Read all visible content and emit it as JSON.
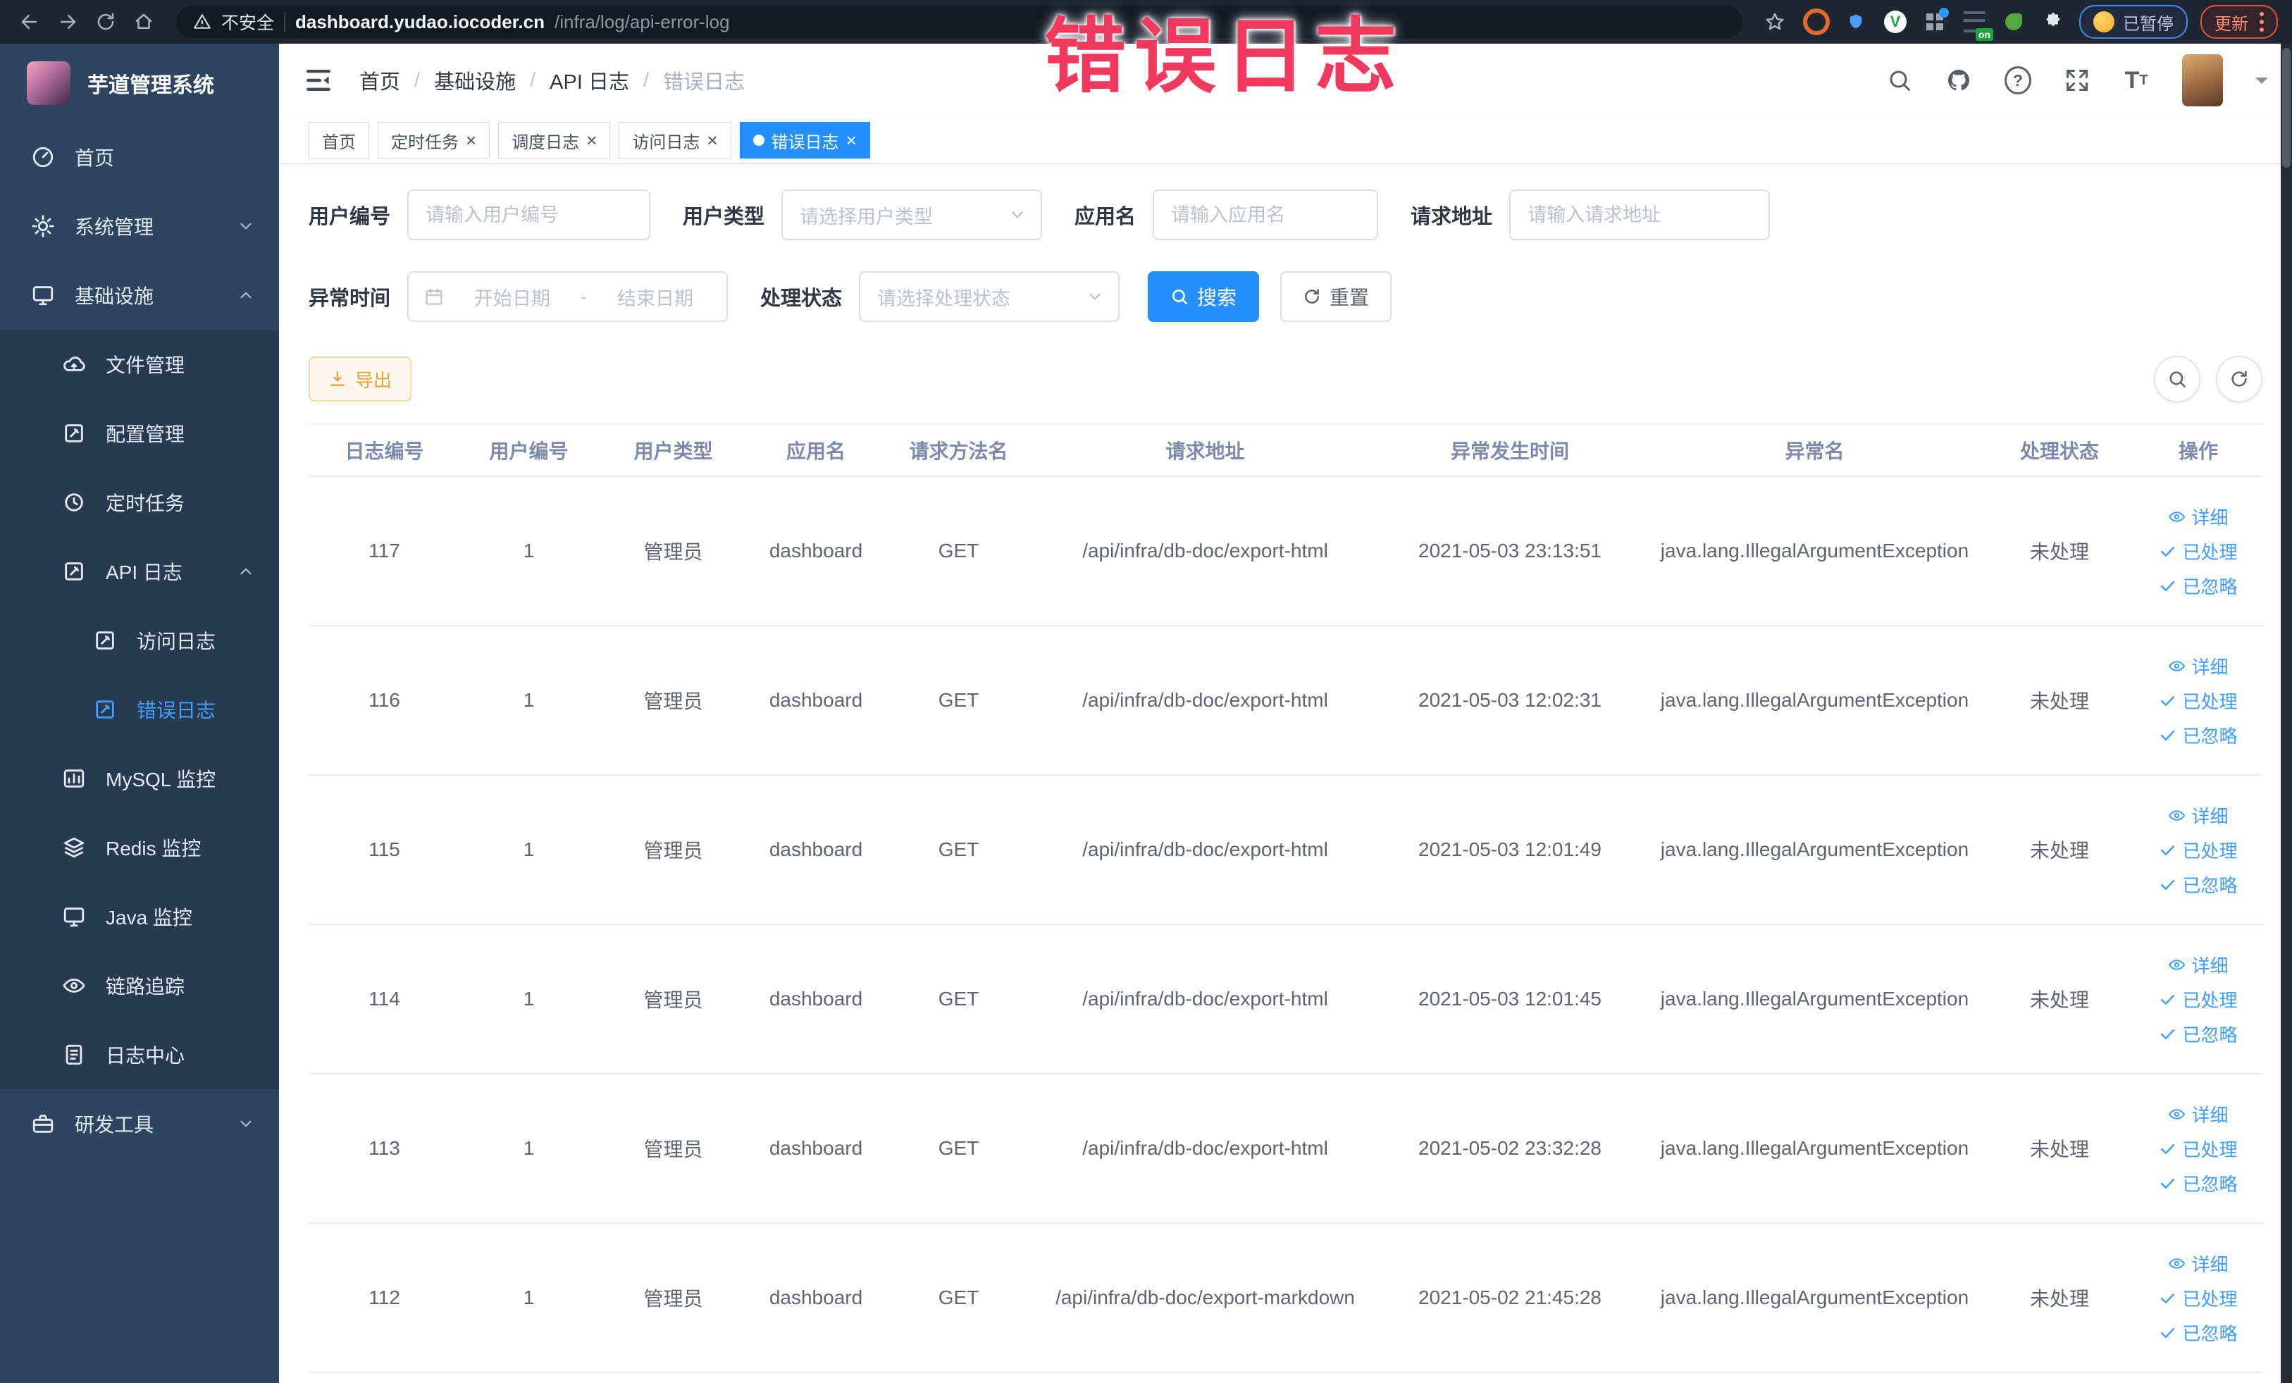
{
  "browser": {
    "security_label": "不安全",
    "url_host": "dashboard.yudao.iocoder.cn",
    "url_path": "/infra/log/api-error-log",
    "paused_badge": "已暂停",
    "update_label": "更新"
  },
  "overlay_title": {
    "text": "错误日志",
    "color": "#f1395f"
  },
  "sidebar": {
    "logo_title": "芋道管理系统",
    "items": [
      {
        "label": "首页"
      },
      {
        "label": "系统管理"
      },
      {
        "label": "基础设施"
      },
      {
        "label": "文件管理"
      },
      {
        "label": "配置管理"
      },
      {
        "label": "定时任务"
      },
      {
        "label": "API 日志"
      },
      {
        "label": "访问日志"
      },
      {
        "label": "错误日志"
      },
      {
        "label": "MySQL 监控"
      },
      {
        "label": "Redis 监控"
      },
      {
        "label": "Java 监控"
      },
      {
        "label": "链路追踪"
      },
      {
        "label": "日志中心"
      },
      {
        "label": "研发工具"
      }
    ]
  },
  "breadcrumb": {
    "separator": "/",
    "items": [
      "首页",
      "基础设施",
      "API 日志",
      "错误日志"
    ]
  },
  "tabs": [
    {
      "label": "首页"
    },
    {
      "label": "定时任务",
      "close": "×"
    },
    {
      "label": "调度日志",
      "close": "×"
    },
    {
      "label": "访问日志",
      "close": "×"
    },
    {
      "label": "错误日志",
      "close": "×"
    }
  ],
  "filters": {
    "user_id": {
      "label": "用户编号",
      "placeholder": "请输入用户编号"
    },
    "user_type": {
      "label": "用户类型",
      "placeholder": "请选择用户类型"
    },
    "app_name": {
      "label": "应用名",
      "placeholder": "请输入应用名"
    },
    "request_url": {
      "label": "请求地址",
      "placeholder": "请输入请求地址"
    },
    "exception_time": {
      "label": "异常时间",
      "start_placeholder": "开始日期",
      "separator": "-",
      "end_placeholder": "结束日期"
    },
    "process_status": {
      "label": "处理状态",
      "placeholder": "请选择处理状态"
    },
    "search_label": "搜索",
    "reset_label": "重置"
  },
  "toolbar": {
    "export_label": "导出"
  },
  "table": {
    "columns": [
      "日志编号",
      "用户编号",
      "用户类型",
      "应用名",
      "请求方法名",
      "请求地址",
      "异常发生时间",
      "异常名",
      "处理状态",
      "操作"
    ],
    "actions": {
      "detail": "详细",
      "processed": "已处理",
      "ignored": "已忽略"
    },
    "rows": [
      {
        "id": "117",
        "user_id": "1",
        "user_type": "管理员",
        "app": "dashboard",
        "method": "GET",
        "url": "/api/infra/db-doc/export-html",
        "time": "2021-05-03 23:13:51",
        "exception": "java.lang.IllegalArgumentException",
        "status": "未处理"
      },
      {
        "id": "116",
        "user_id": "1",
        "user_type": "管理员",
        "app": "dashboard",
        "method": "GET",
        "url": "/api/infra/db-doc/export-html",
        "time": "2021-05-03 12:02:31",
        "exception": "java.lang.IllegalArgumentException",
        "status": "未处理"
      },
      {
        "id": "115",
        "user_id": "1",
        "user_type": "管理员",
        "app": "dashboard",
        "method": "GET",
        "url": "/api/infra/db-doc/export-html",
        "time": "2021-05-03 12:01:49",
        "exception": "java.lang.IllegalArgumentException",
        "status": "未处理"
      },
      {
        "id": "114",
        "user_id": "1",
        "user_type": "管理员",
        "app": "dashboard",
        "method": "GET",
        "url": "/api/infra/db-doc/export-html",
        "time": "2021-05-03 12:01:45",
        "exception": "java.lang.IllegalArgumentException",
        "status": "未处理"
      },
      {
        "id": "113",
        "user_id": "1",
        "user_type": "管理员",
        "app": "dashboard",
        "method": "GET",
        "url": "/api/infra/db-doc/export-html",
        "time": "2021-05-02 23:32:28",
        "exception": "java.lang.IllegalArgumentException",
        "status": "未处理"
      },
      {
        "id": "112",
        "user_id": "1",
        "user_type": "管理员",
        "app": "dashboard",
        "method": "GET",
        "url": "/api/infra/db-doc/export-markdown",
        "time": "2021-05-02 21:45:28",
        "exception": "java.lang.IllegalArgumentException",
        "status": "未处理"
      }
    ]
  },
  "colors": {
    "primary": "#2490fd",
    "link": "#409eff",
    "warning": "#e6a23c",
    "sidebar_bg": "#2d4560",
    "submenu_bg": "#273a50"
  }
}
